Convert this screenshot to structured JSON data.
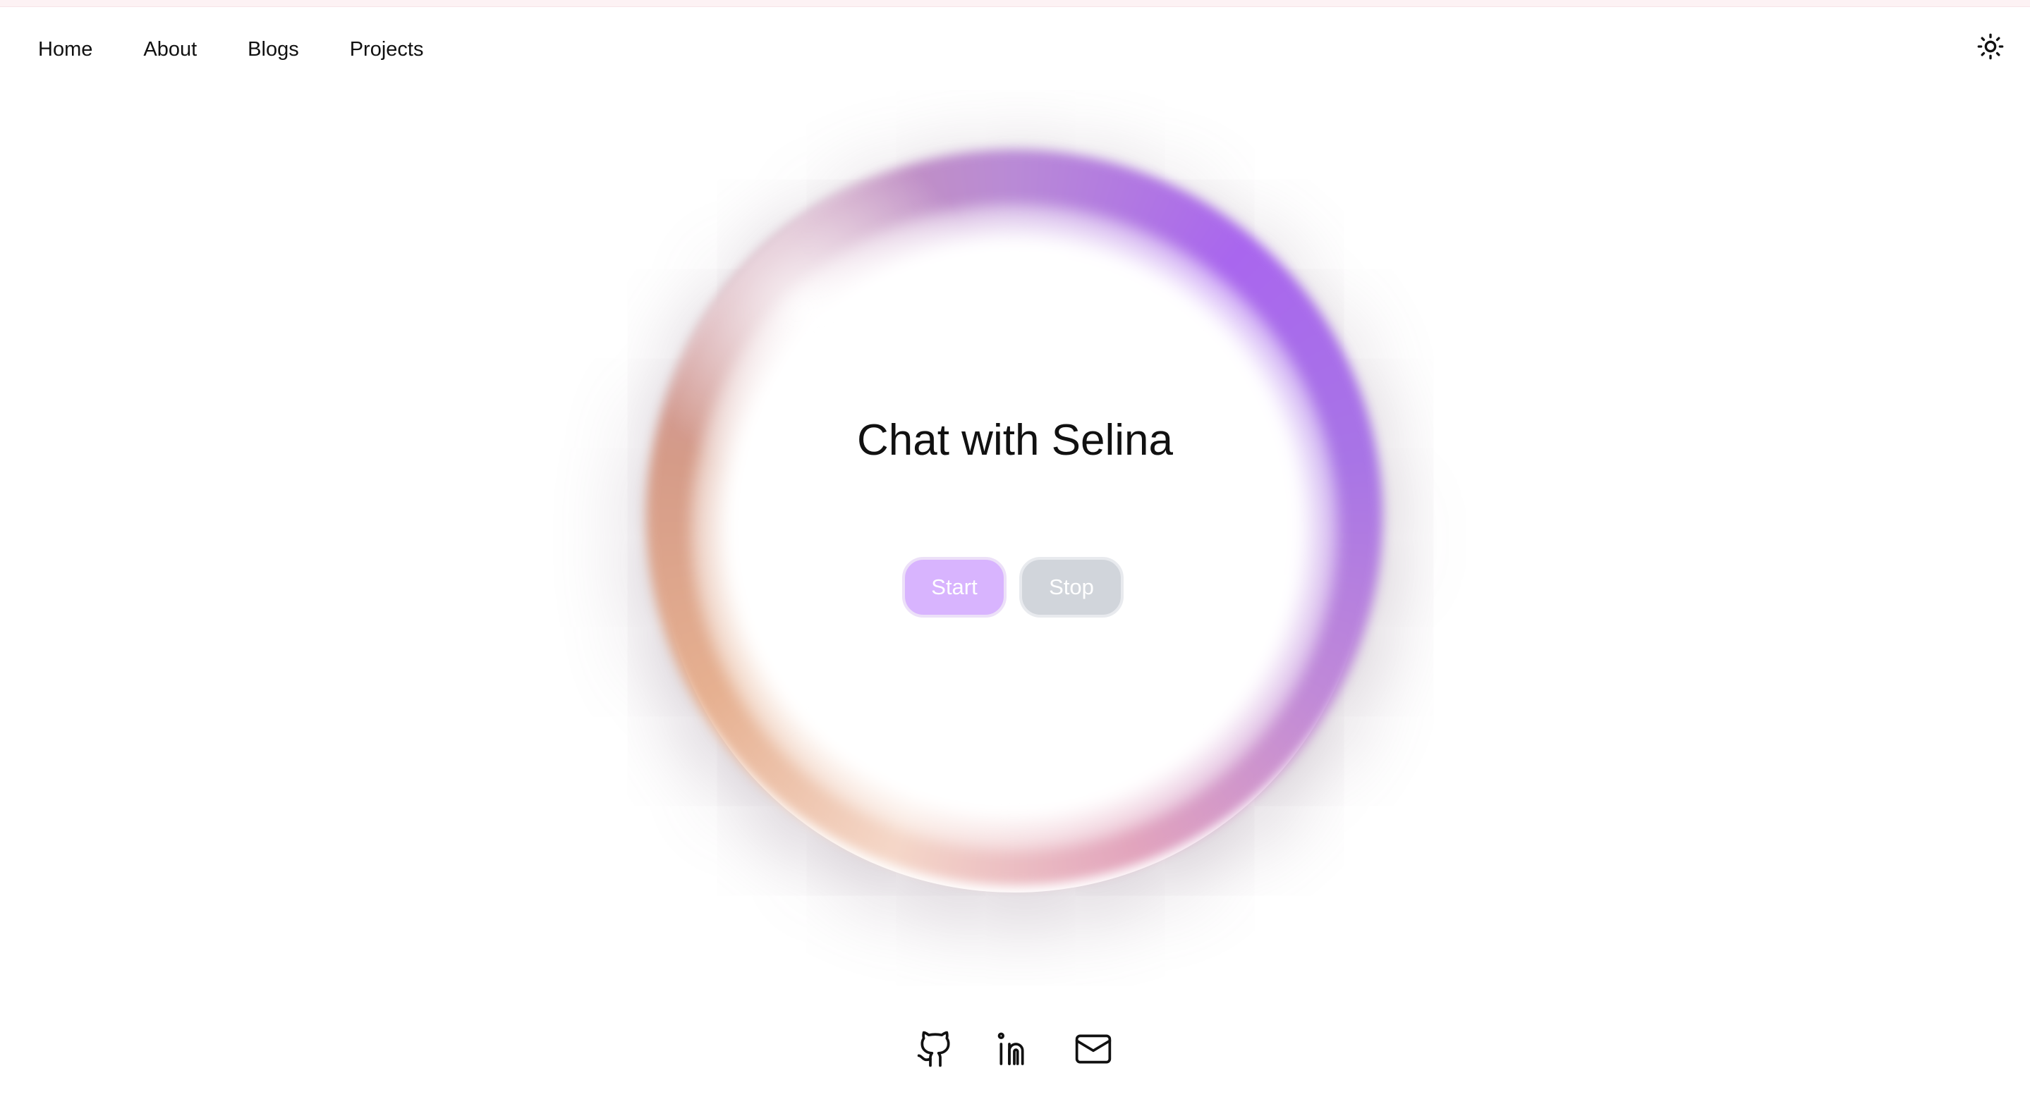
{
  "nav": {
    "items": [
      {
        "label": "Home"
      },
      {
        "label": "About"
      },
      {
        "label": "Blogs"
      },
      {
        "label": "Projects"
      }
    ],
    "theme_toggle_icon": "sun-icon"
  },
  "hero": {
    "title": "Chat with Selina",
    "start_label": "Start",
    "stop_label": "Stop"
  },
  "footer": {
    "links": [
      {
        "icon": "github-icon"
      },
      {
        "icon": "linkedin-icon"
      },
      {
        "icon": "mail-icon"
      }
    ]
  },
  "colors": {
    "start_button": "#d8b4fe",
    "stop_button": "#d1d5db",
    "orb_accent": "#a966ee"
  }
}
